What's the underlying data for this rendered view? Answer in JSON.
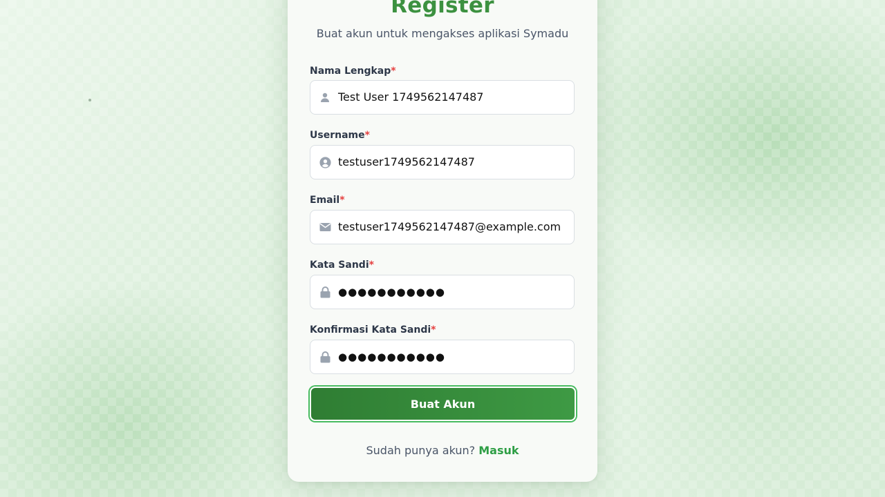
{
  "page": {
    "title": "Register",
    "subtitle": "Buat akun untuk mengakses aplikasi Symadu"
  },
  "form": {
    "fields": [
      {
        "label": "Nama Lengkap",
        "required_mark": "*",
        "value": "Test User 1749562147487",
        "icon": "user-icon"
      },
      {
        "label": "Username",
        "required_mark": "*",
        "value": "testuser1749562147487",
        "icon": "user-circle-icon"
      },
      {
        "label": "Email",
        "required_mark": "*",
        "value": "testuser1749562147487@example.com",
        "icon": "envelope-icon"
      },
      {
        "label": "Kata Sandi",
        "required_mark": "*",
        "value": "●●●●●●●●●●●",
        "icon": "lock-icon"
      },
      {
        "label": "Konfirmasi Kata Sandi",
        "required_mark": "*",
        "value": "●●●●●●●●●●●",
        "icon": "lock-icon"
      }
    ],
    "submit_label": "Buat Akun"
  },
  "footer": {
    "prompt": "Sudah punya akun?",
    "link_label": "Masuk"
  },
  "colors": {
    "brand": "#3c9140",
    "button": "#2f7d33",
    "link": "#2e9e45",
    "required": "#e53e3e"
  }
}
